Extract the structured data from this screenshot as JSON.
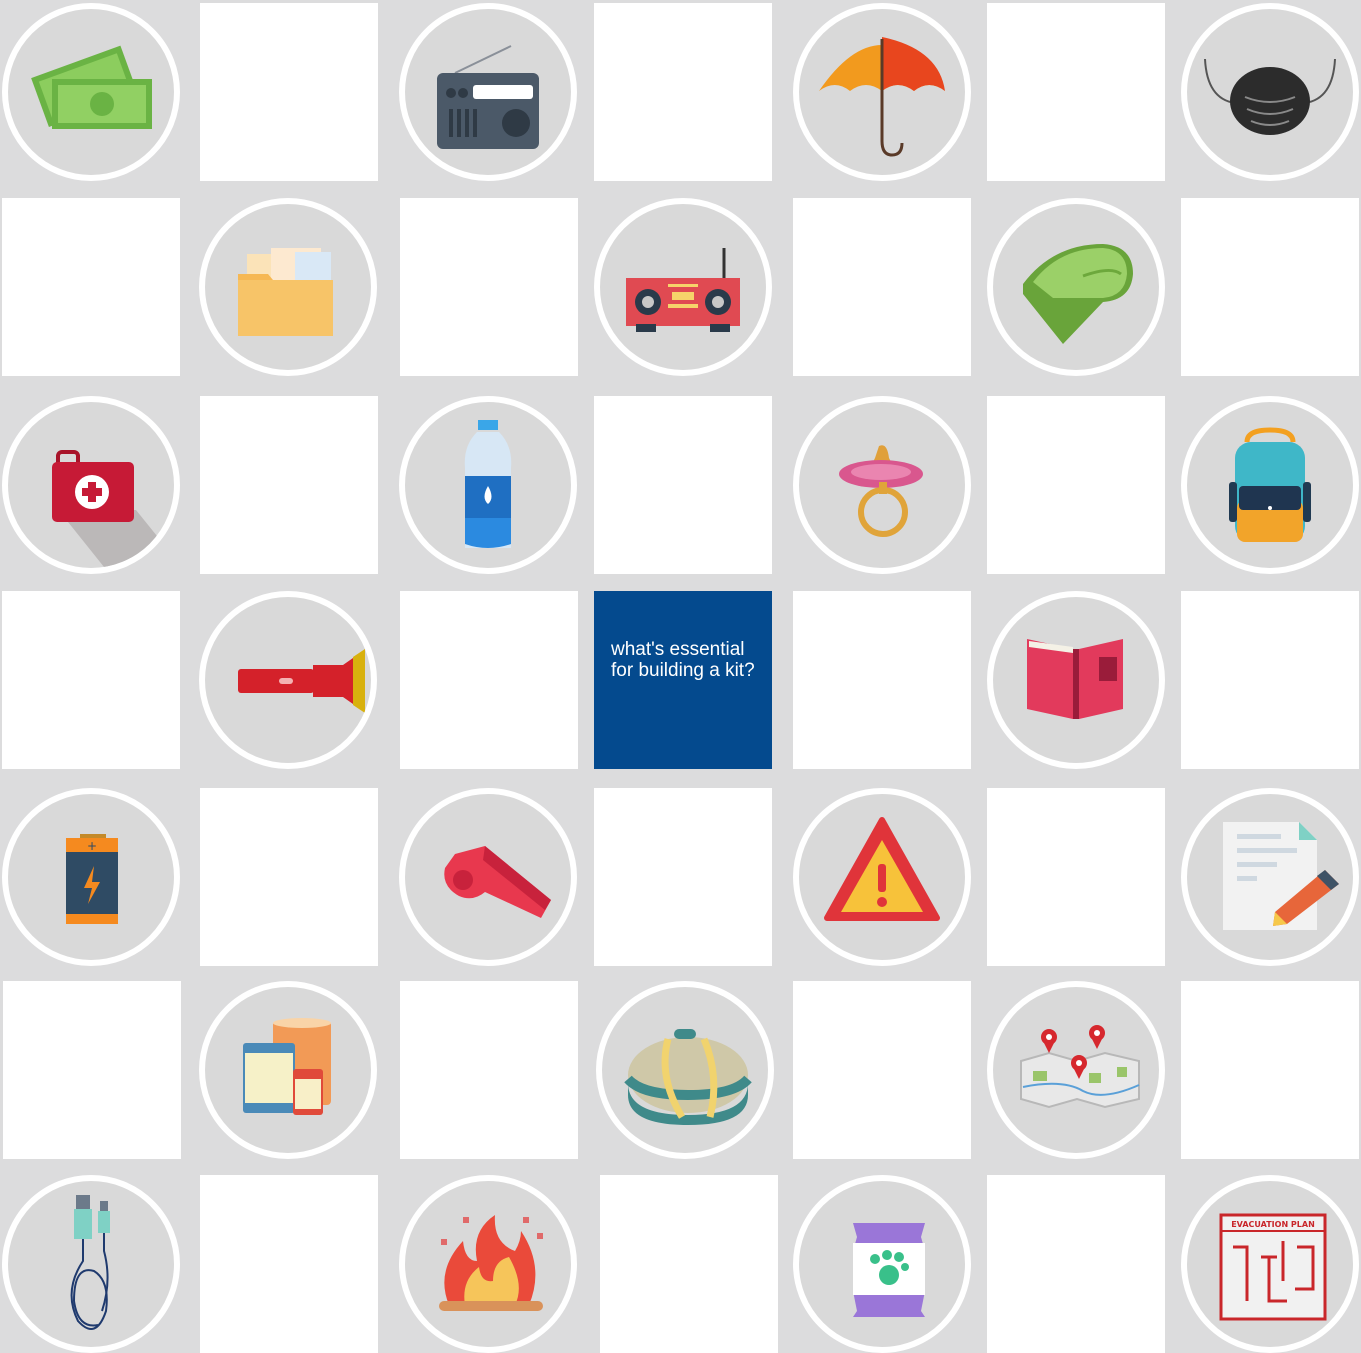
{
  "board": {
    "prompt": "what's essential for building a kit?",
    "colors": {
      "background": "#dcdcdd",
      "tile": "#ffffff",
      "center_tile": "#044a8e",
      "circle_fill": "#d9d9d9",
      "circle_ring": "#ffffff"
    },
    "items": [
      {
        "icon": "cash-icon"
      },
      {
        "icon": "radio-icon"
      },
      {
        "icon": "umbrella-icon"
      },
      {
        "icon": "face-mask-icon"
      },
      {
        "icon": "documents-folder-icon"
      },
      {
        "icon": "boombox-radio-icon"
      },
      {
        "icon": "blanket-icon"
      },
      {
        "icon": "first-aid-kit-icon"
      },
      {
        "icon": "water-bottle-icon"
      },
      {
        "icon": "pacifier-icon"
      },
      {
        "icon": "backpack-icon"
      },
      {
        "icon": "flashlight-icon"
      },
      {
        "icon": "book-icon"
      },
      {
        "icon": "battery-icon"
      },
      {
        "icon": "whistle-icon"
      },
      {
        "icon": "warning-sign-icon"
      },
      {
        "icon": "notepad-pencil-icon"
      },
      {
        "icon": "canned-food-icon"
      },
      {
        "icon": "duffel-bag-icon"
      },
      {
        "icon": "map-icon"
      },
      {
        "icon": "charging-cable-icon"
      },
      {
        "icon": "fire-icon"
      },
      {
        "icon": "pet-food-icon"
      },
      {
        "icon": "evacuation-plan-icon"
      }
    ],
    "evacuation_plan_label": "EVACUATION PLAN"
  }
}
